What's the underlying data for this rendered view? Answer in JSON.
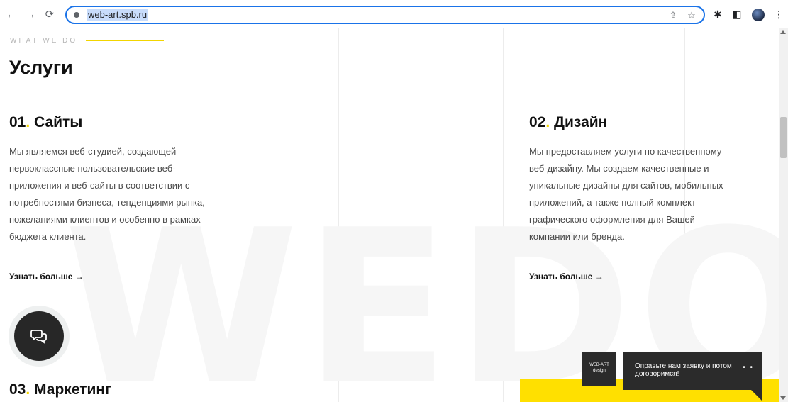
{
  "browser": {
    "url": "web-art.spb.ru",
    "back_icon": "←",
    "forward_icon": "→",
    "reload_icon": "⟳",
    "share_icon": "⇪",
    "star_icon": "☆",
    "extensions_icon": "✱",
    "sidepanel_icon": "◧",
    "menu_icon": "⋮"
  },
  "section": {
    "eyebrow": "WHAT WE DO",
    "title": "Услуги",
    "watermark": "WEDO"
  },
  "services": [
    {
      "number": "01",
      "dot": ".",
      "name": "Сайты",
      "lines": [
        "Мы являемся веб-студией, создающей",
        "первоклассные пользовательские веб-",
        "приложения и веб-сайты в соответствии с",
        "потребностями бизнеса, тенденциями рынка,",
        "пожеланиями клиентов и особенно в рамках",
        "бюджета клиента."
      ],
      "more": "Узнать больше →"
    },
    {
      "number": "02",
      "dot": ".",
      "name": "Дизайн",
      "lines": [
        "Мы предоставляем услуги по качественному",
        "веб-дизайну. Мы создаем качественные и",
        "уникальные дизайны для сайтов, мобильных",
        "приложений, а также полный комплект",
        "графического оформления для Вашей",
        "компании или бренда."
      ],
      "more": "Узнать больше →"
    },
    {
      "number": "03",
      "dot": ".",
      "name": "Маркетинг"
    }
  ],
  "widget": {
    "logo_text": "WEB-ART design",
    "message": "Оправьте нам заявку и потом договоримся!",
    "dots": "• •"
  },
  "colors": {
    "accent": "#ffe000",
    "dark": "#2b2b2b",
    "url_focus": "#1a73e8"
  }
}
